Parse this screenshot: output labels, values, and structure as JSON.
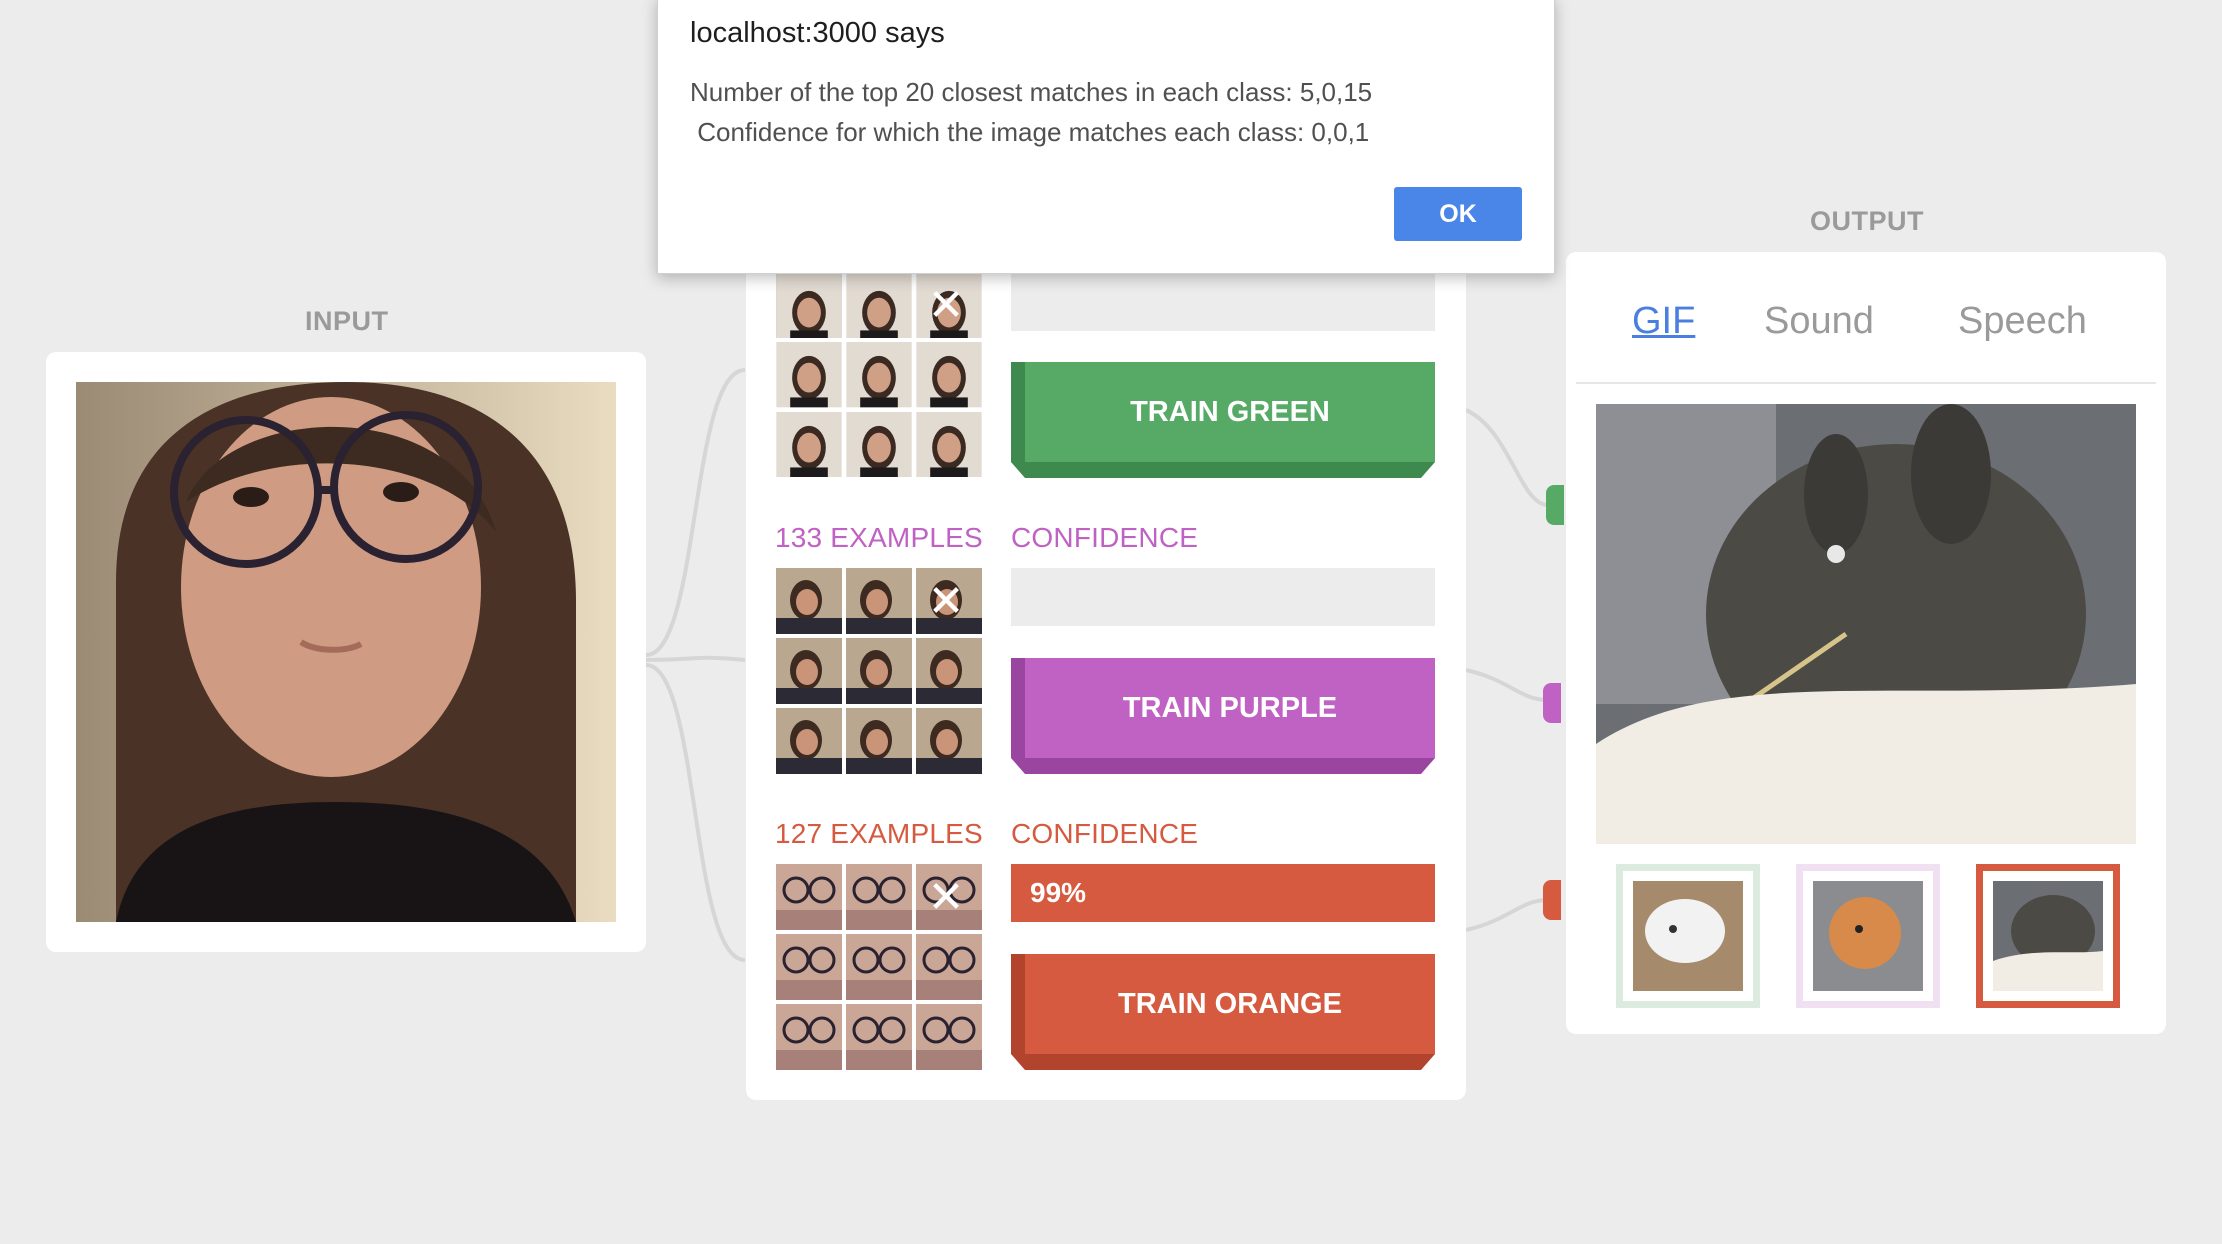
{
  "dialog": {
    "title": "localhost:3000 says",
    "line1": "Number of the top 20 closest matches in each class: 5,0,15",
    "line2": " Confidence for which the image matches each class: 0,0,1",
    "ok_label": "OK"
  },
  "input": {
    "section_title": "INPUT"
  },
  "classes": [
    {
      "name": "green",
      "color": "#56aa66",
      "shade": "#3e8a4e",
      "examples_label": "",
      "confidence_label": "",
      "confidence_value": "",
      "train_label": "TRAIN GREEN"
    },
    {
      "name": "purple",
      "color": "#c062c4",
      "shade": "#9a45a0",
      "examples_label": "133 EXAMPLES",
      "confidence_label": "CONFIDENCE",
      "confidence_value": "",
      "train_label": "TRAIN PURPLE"
    },
    {
      "name": "orange",
      "color": "#d55a3f",
      "shade": "#b2432c",
      "examples_label": "127 EXAMPLES",
      "confidence_label": "CONFIDENCE",
      "confidence_value": "99%",
      "train_label": "TRAIN ORANGE"
    }
  ],
  "output": {
    "section_title": "OUTPUT",
    "tabs": [
      "GIF",
      "Sound",
      "Speech"
    ],
    "active_tab": "GIF"
  },
  "icons": {
    "remove": "close-icon"
  }
}
